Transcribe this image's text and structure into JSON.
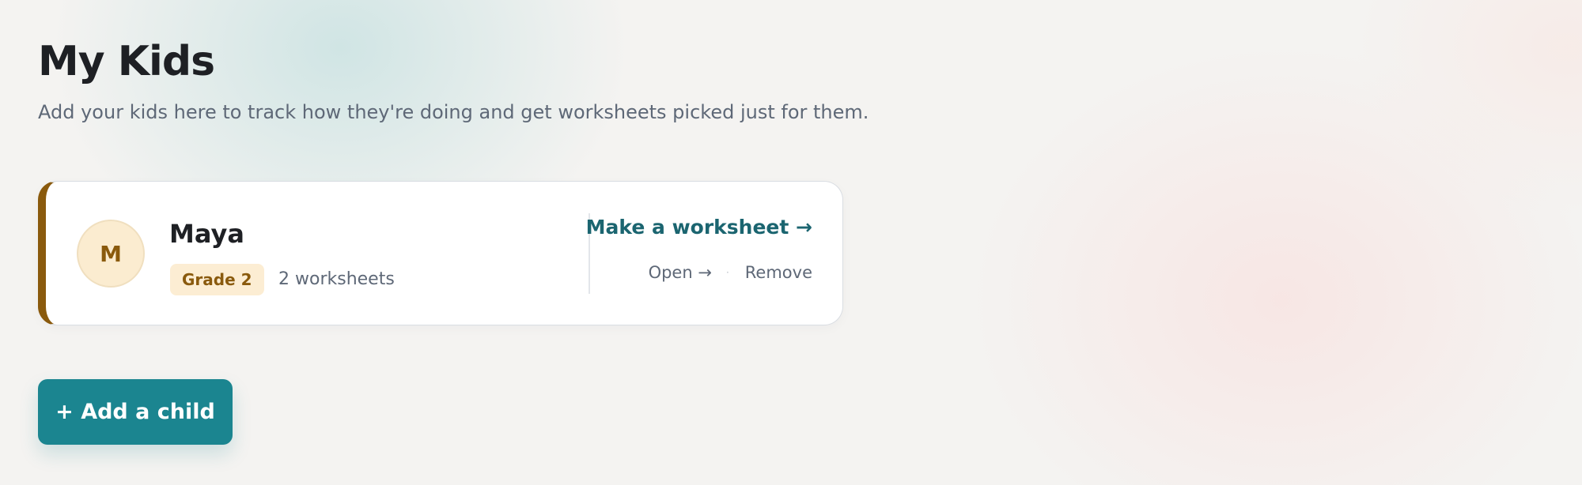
{
  "header": {
    "title": "My Kids",
    "subtitle": "Add your kids here to track how they're doing and get worksheets picked just for them."
  },
  "children": [
    {
      "initial": "M",
      "name": "Maya",
      "grade": "Grade 2",
      "worksheets": "2 worksheets",
      "make_worksheet_label": "Make a worksheet →",
      "open_label": "Open →",
      "separator": "·",
      "remove_label": "Remove"
    }
  ],
  "actions": {
    "add_child_label": "+ Add a child"
  },
  "colors": {
    "accent": "#1b8590",
    "link": "#1b6570",
    "card_stripe": "#8a5a0d",
    "badge_bg": "#fcedd3"
  }
}
